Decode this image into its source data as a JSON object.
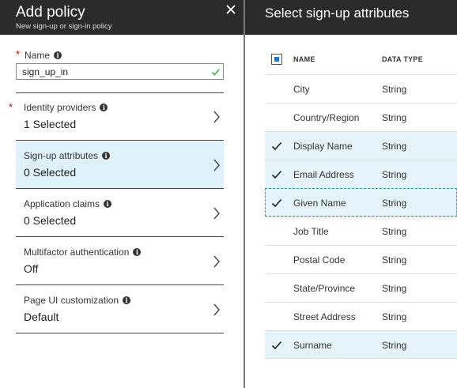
{
  "left_blade": {
    "title": "Add policy",
    "subtitle": "New sign-up or sign-in policy",
    "name_field": {
      "label": "Name",
      "value": "sign_up_in"
    },
    "items": [
      {
        "label": "Identity providers",
        "value": "1 Selected",
        "required": true
      },
      {
        "label": "Sign-up attributes",
        "value": "0 Selected",
        "required": false,
        "selected": true
      },
      {
        "label": "Application claims",
        "value": "0 Selected",
        "required": false
      },
      {
        "label": "Multifactor authentication",
        "value": "Off",
        "required": false
      },
      {
        "label": "Page UI customization",
        "value": "Default",
        "required": false
      }
    ]
  },
  "right_blade": {
    "title": "Select sign-up attributes",
    "columns": {
      "name": "NAME",
      "data_type": "DATA TYPE"
    },
    "rows": [
      {
        "name": "City",
        "type": "String",
        "checked": false
      },
      {
        "name": "Country/Region",
        "type": "String",
        "checked": false
      },
      {
        "name": "Display Name",
        "type": "String",
        "checked": true
      },
      {
        "name": "Email Address",
        "type": "String",
        "checked": true
      },
      {
        "name": "Given Name",
        "type": "String",
        "checked": true,
        "focused": true
      },
      {
        "name": "Job Title",
        "type": "String",
        "checked": false
      },
      {
        "name": "Postal Code",
        "type": "String",
        "checked": false
      },
      {
        "name": "State/Province",
        "type": "String",
        "checked": false
      },
      {
        "name": "Street Address",
        "type": "String",
        "checked": false
      },
      {
        "name": "Surname",
        "type": "String",
        "checked": true
      }
    ]
  },
  "colors": {
    "header_bg": "#2b2b2b",
    "selected_bg": "#dff1fa",
    "required": "#cc0000",
    "valid": "#5cb85c",
    "accent": "#1e7ad4"
  },
  "icons": {
    "close": "close-icon",
    "info": "info-icon",
    "chevron": "chevron-right-icon",
    "check": "checkmark-icon"
  }
}
